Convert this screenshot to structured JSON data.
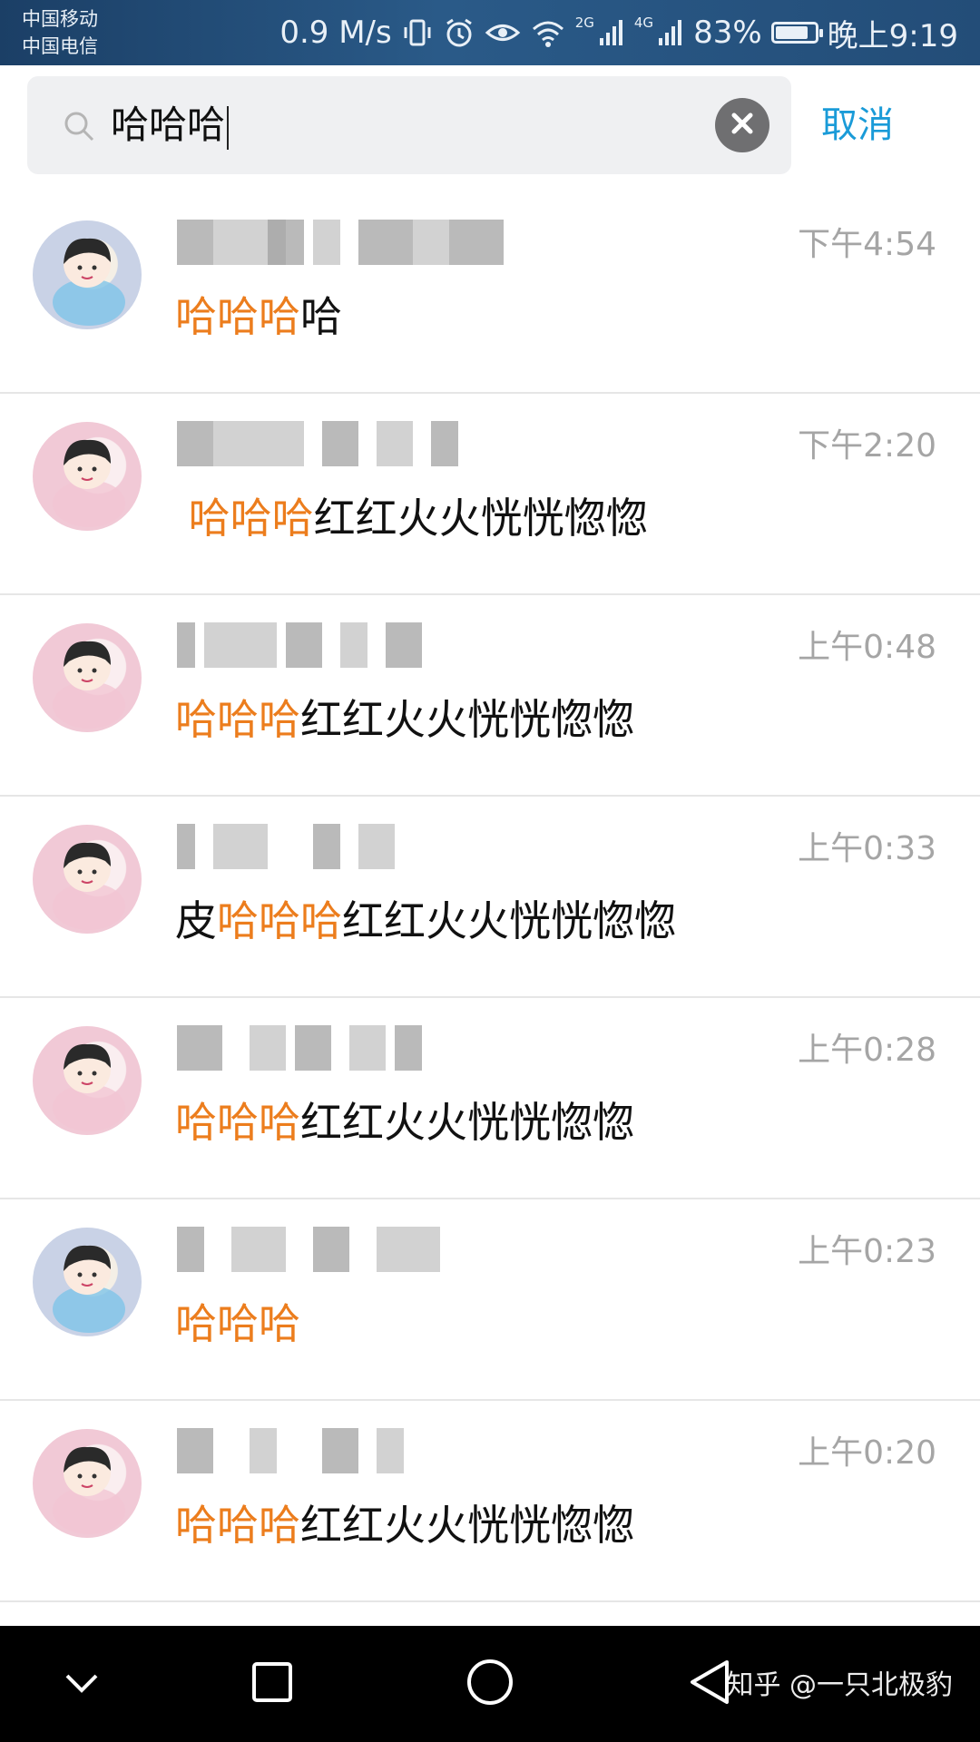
{
  "status_bar": {
    "carrier_1": "中国移动",
    "carrier_2": "中国电信",
    "net_speed": "0.9 M/s",
    "net_2g": "2G",
    "net_4g": "4G",
    "battery": "83%",
    "battery_level": 0.83,
    "time": "晚上9:19"
  },
  "search": {
    "query": "哈哈哈",
    "cancel_label": "取消"
  },
  "results": [
    {
      "avatar": "blue",
      "time": "下午4:54",
      "pre": "",
      "hl": "哈哈哈",
      "post": "哈"
    },
    {
      "avatar": "pink",
      "time": "下午2:20",
      "pre": " ",
      "hl": "哈哈哈",
      "post": "红红火火恍恍惚惚"
    },
    {
      "avatar": "pink",
      "time": "上午0:48",
      "pre": "",
      "hl": "哈哈哈",
      "post": "红红火火恍恍惚惚"
    },
    {
      "avatar": "pink",
      "time": "上午0:33",
      "pre": "皮",
      "hl": "哈哈哈",
      "post": "红红火火恍恍惚惚"
    },
    {
      "avatar": "pink",
      "time": "上午0:28",
      "pre": "",
      "hl": "哈哈哈",
      "post": "红红火火恍恍惚惚"
    },
    {
      "avatar": "blue",
      "time": "上午0:23",
      "pre": "",
      "hl": "哈哈哈",
      "post": ""
    },
    {
      "avatar": "pink",
      "time": "上午0:20",
      "pre": "",
      "hl": "哈哈哈",
      "post": "红红火火恍恍惚惚"
    }
  ],
  "watermark": "知乎 @一只北极豹",
  "colors": {
    "highlight": "#ec7d1d",
    "accent": "#1a9bd8",
    "status_bar": "#1b3f66"
  }
}
